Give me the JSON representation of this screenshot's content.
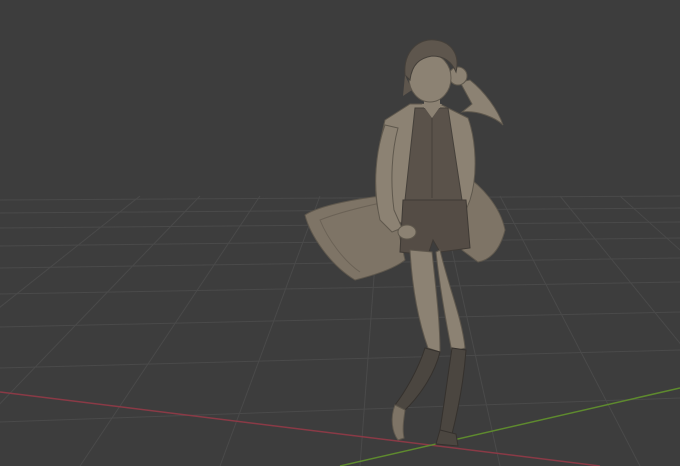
{
  "viewport": {
    "background": "#3d3d3d",
    "grid_color": "#4a4a4a",
    "x_axis_color": "#8a3a46",
    "y_axis_color": "#5e8a2e"
  },
  "model": {
    "icon": "sculpted-figure",
    "base_color": "#8c8273",
    "shadow_color": "#6f6658",
    "dark_color": "#4b4640",
    "outfit_color": "#544c45"
  }
}
